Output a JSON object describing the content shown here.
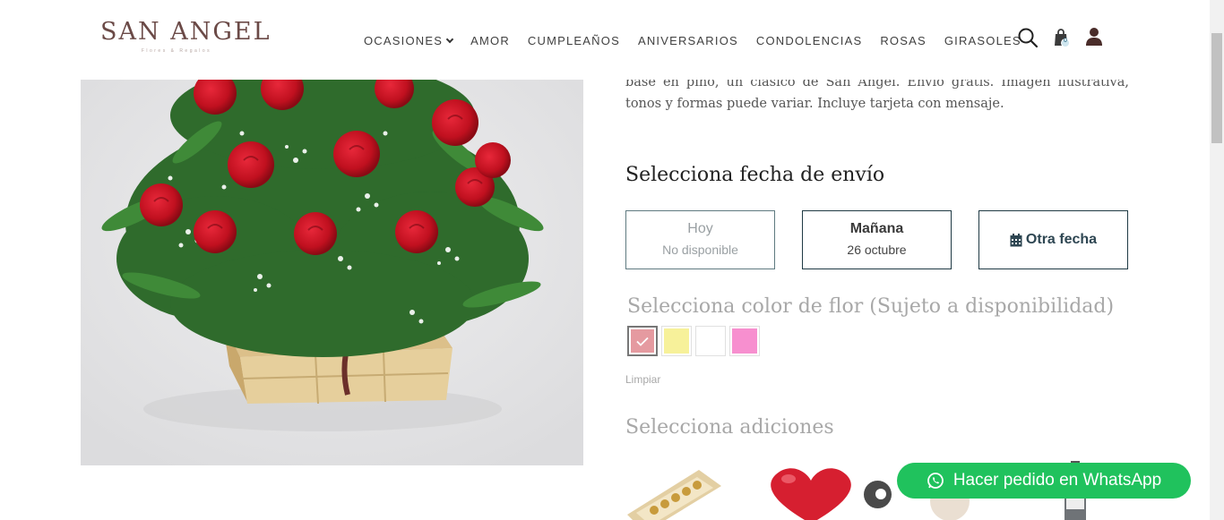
{
  "header": {
    "logo_main": "SAN ANGEL",
    "logo_sub": "Flores & Regalos",
    "nav": [
      "OCASIONES",
      "AMOR",
      "CUMPLEAÑOS",
      "ANIVERSARIOS",
      "CONDOLENCIAS",
      "ROSAS",
      "GIRASOLES"
    ],
    "icons": [
      "search-icon",
      "shopping-bag-icon",
      "user-icon"
    ],
    "cart_count": "0"
  },
  "product": {
    "description": "base en pino, un clásico de San Angel. Envío gratis. Imagen ilustrativa, tonos y formas puede variar. Incluye tarjeta con mensaje."
  },
  "delivery": {
    "title": "Selecciona fecha de envío",
    "options": [
      {
        "title": "Hoy",
        "sub": "No disponible"
      },
      {
        "title": "Mañana",
        "sub": "26 octubre"
      },
      {
        "title": "Otra fecha"
      }
    ]
  },
  "colors": {
    "title": "Selecciona color de flor (Sujeto a disponibilidad)",
    "swatches": [
      "#e59aa0",
      "#f7f19a",
      "#ffffff",
      "#f78fcf"
    ],
    "selected_index": 0,
    "clear_label": "Limpiar"
  },
  "addons": {
    "title": "Selecciona adiciones",
    "items": [
      "chocolate-box",
      "heart-balloon",
      "teddy-bear",
      "wine-bottle"
    ]
  },
  "whatsapp": {
    "label": "Hacer pedido en WhatsApp",
    "color": "#20c25d"
  },
  "theme": {
    "accent": "#1f3a44",
    "brand": "#6b4a47"
  }
}
